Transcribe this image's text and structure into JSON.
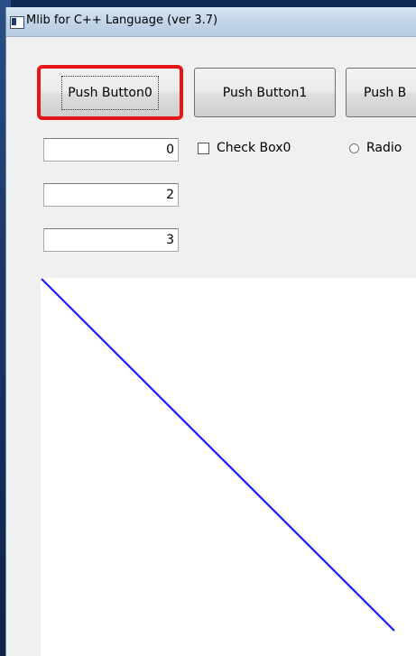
{
  "window": {
    "title": "Mlib for C++ Language  (ver 3.7)"
  },
  "buttons": [
    {
      "label": "Push Button0"
    },
    {
      "label": "Push Button1"
    },
    {
      "label": "Push B"
    }
  ],
  "edits": [
    {
      "value": "0"
    },
    {
      "value": "2"
    },
    {
      "value": "3"
    }
  ],
  "checkbox": {
    "label": "Check Box0",
    "checked": false
  },
  "radio": {
    "label": "Radio",
    "selected": false
  },
  "canvas": {
    "line_color": "#1a1aff",
    "background": "#ffffff"
  },
  "colors": {
    "focus_outline": "#e51616"
  }
}
